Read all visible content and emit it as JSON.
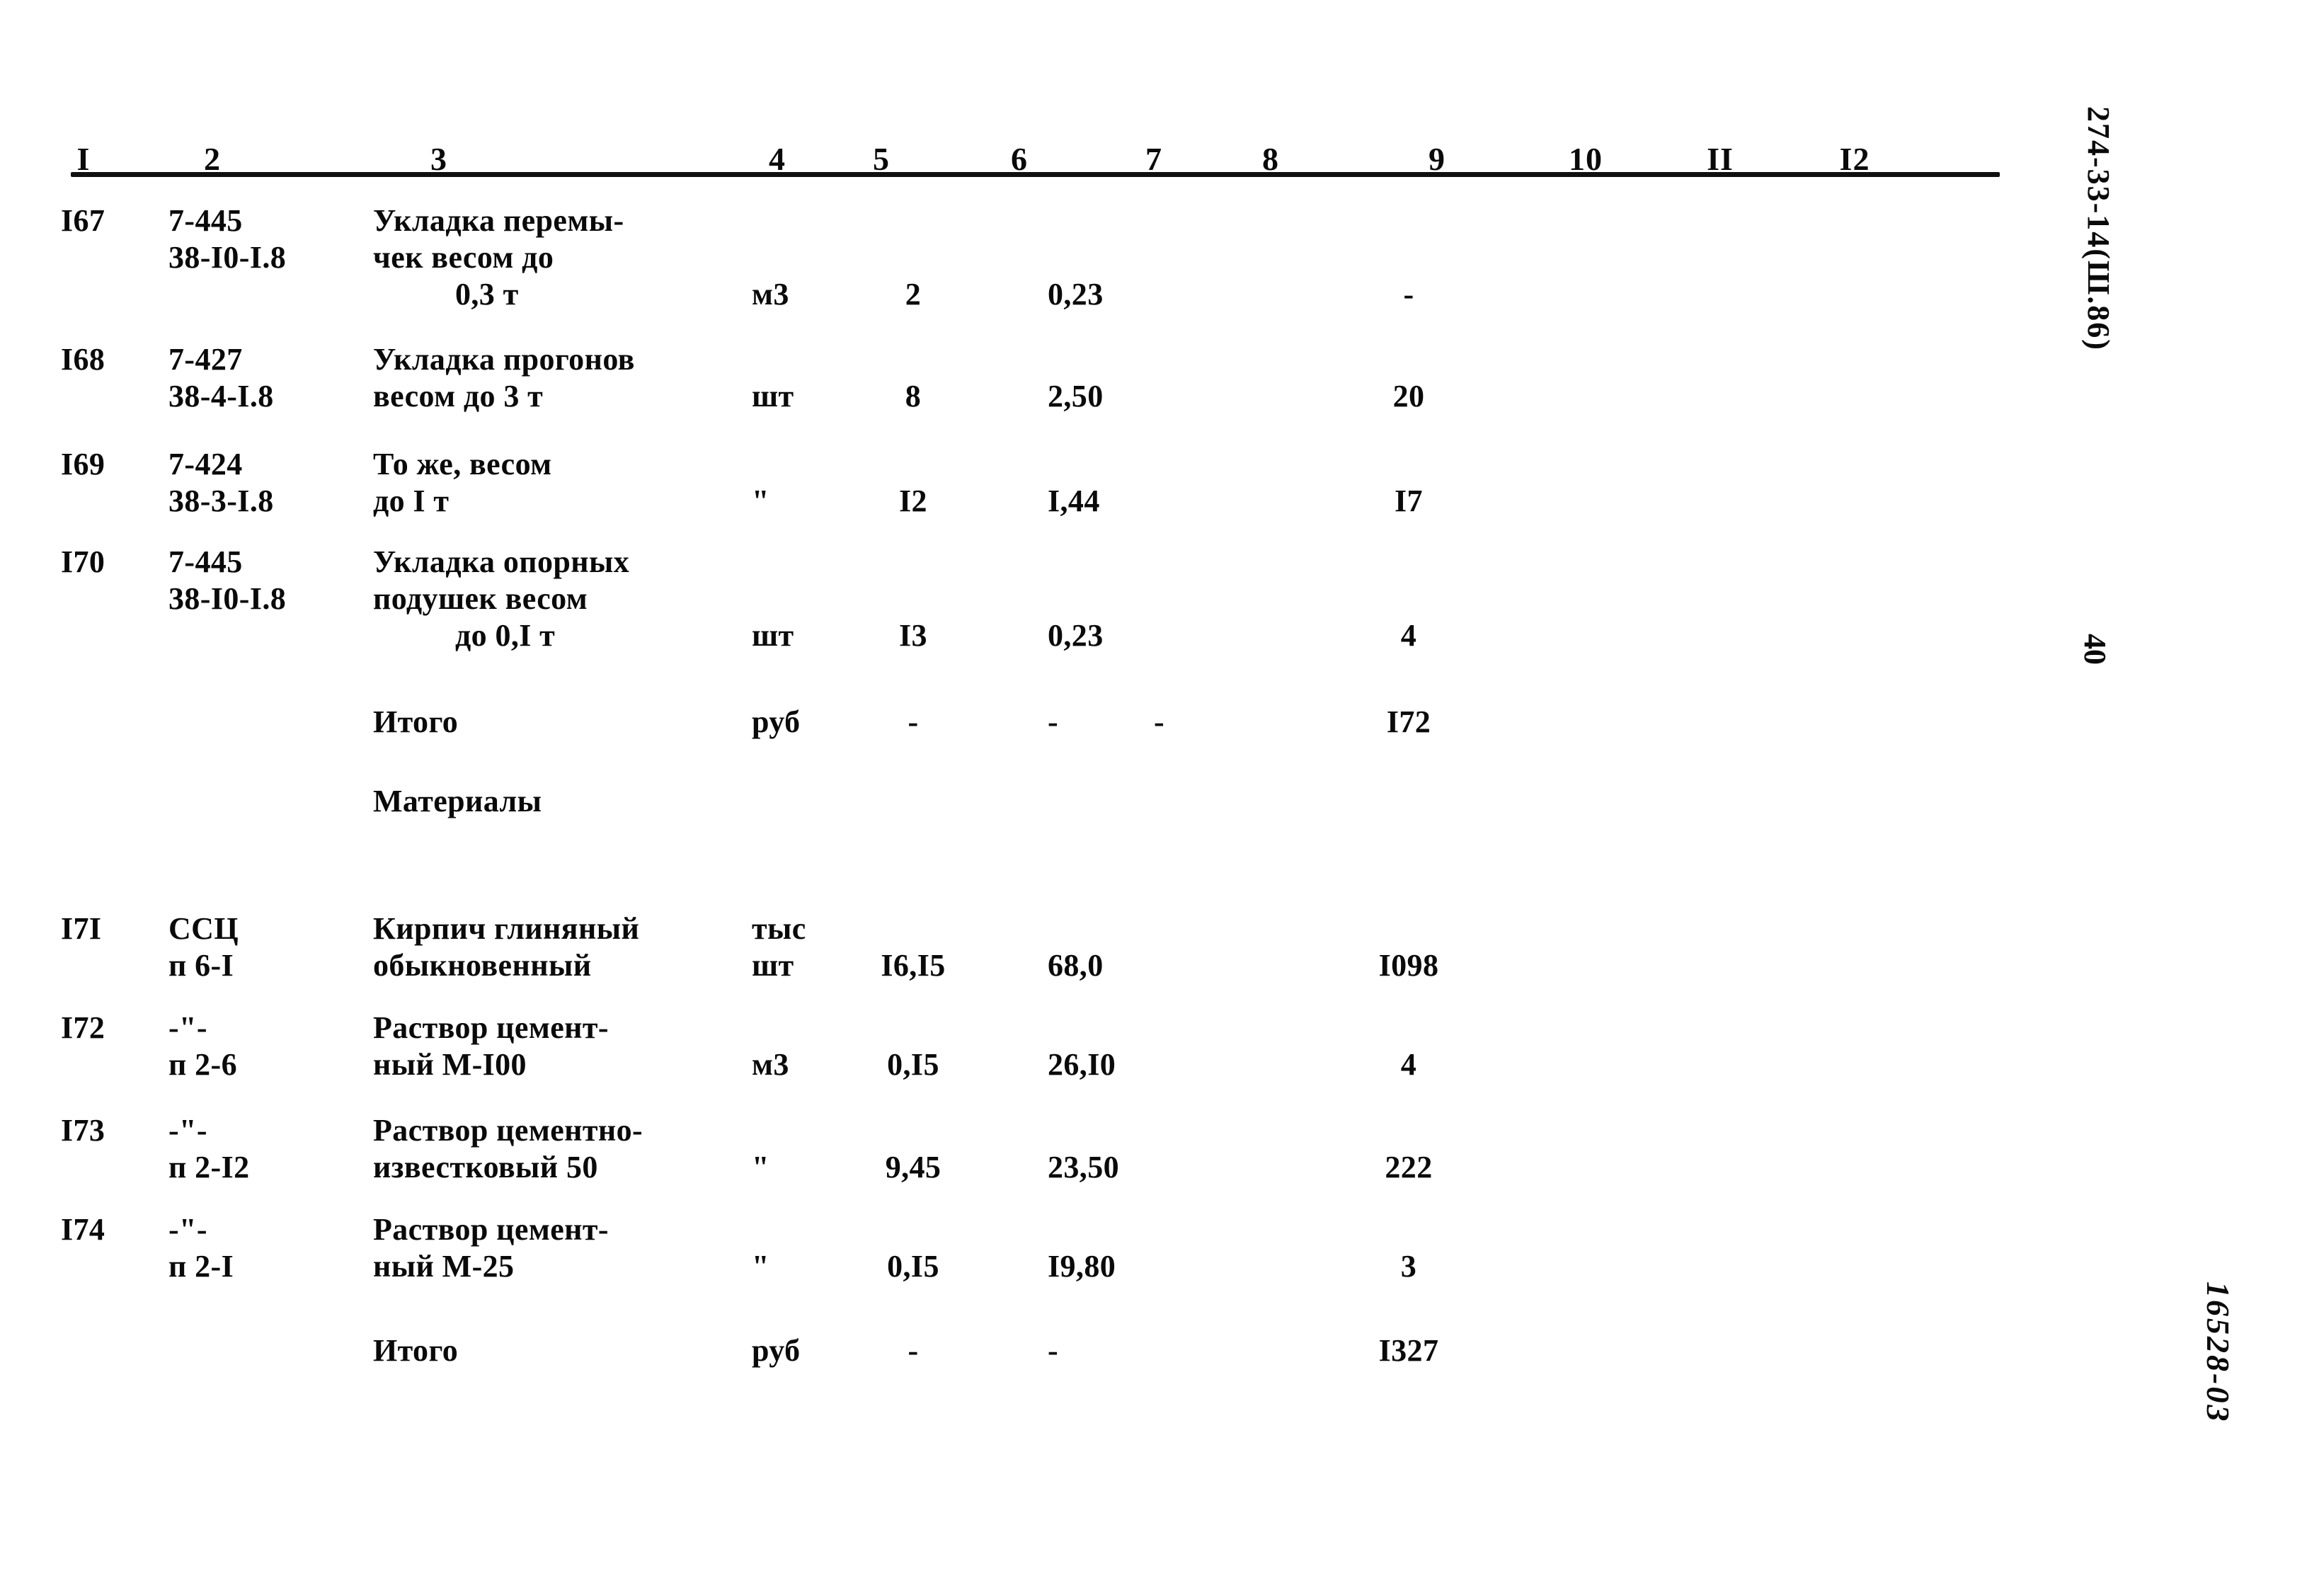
{
  "document": {
    "doc_code": "274-33-14(Ш.86)",
    "page_number": "40",
    "archive_id": "16528-03"
  },
  "table": {
    "column_headers": [
      "I",
      "2",
      "3",
      "4",
      "5",
      "6",
      "7",
      "8",
      "9",
      "10",
      "II",
      "I2"
    ],
    "rows": [
      {
        "num": "I67",
        "code_line1": "7-445",
        "code_line2": "38-I0-I.8",
        "name_line1": "Укладка перемы-",
        "name_line2": "чек весом до",
        "name_line3": "0,3 т",
        "unit": "м3",
        "qty": "2",
        "price": "0,23",
        "col7": "",
        "col9": "-"
      },
      {
        "num": "I68",
        "code_line1": "7-427",
        "code_line2": "38-4-I.8",
        "name_line1": "Укладка прогонов",
        "name_line2": "весом до 3 т",
        "name_line3": "",
        "unit": "шт",
        "qty": "8",
        "price": "2,50",
        "col7": "",
        "col9": "20"
      },
      {
        "num": "I69",
        "code_line1": "7-424",
        "code_line2": "38-3-I.8",
        "name_line1": "То же, весом",
        "name_line2": "до I т",
        "name_line3": "",
        "unit": "\"",
        "qty": "I2",
        "price": "I,44",
        "col7": "",
        "col9": "I7"
      },
      {
        "num": "I70",
        "code_line1": "7-445",
        "code_line2": "38-I0-I.8",
        "name_line1": "Укладка опорных",
        "name_line2": "подушек весом",
        "name_line3": "до 0,I т",
        "unit": "шт",
        "qty": "I3",
        "price": "0,23",
        "col7": "",
        "col9": "4"
      },
      {
        "num": "",
        "code_line1": "",
        "code_line2": "",
        "name_line1": "Итого",
        "name_line2": "",
        "name_line3": "",
        "unit": "руб",
        "qty": "-",
        "price": "-",
        "col7": "-",
        "col9": "I72"
      },
      {
        "num": "",
        "code_line1": "",
        "code_line2": "",
        "name_line1": "Материалы",
        "name_line2": "",
        "name_line3": "",
        "unit": "",
        "qty": "",
        "price": "",
        "col7": "",
        "col9": ""
      },
      {
        "num": "I7I",
        "code_line1": "ССЦ",
        "code_line2": "п 6-I",
        "name_line1": "Кирпич глиняный",
        "name_line2": "обыкновенный",
        "name_line3": "",
        "unit": "тыс\nшт",
        "qty": "I6,I5",
        "price": "68,0",
        "col7": "",
        "col9": "I098"
      },
      {
        "num": "I72",
        "code_line1": "-\"-",
        "code_line2": "п 2-6",
        "name_line1": "Раствор цемент-",
        "name_line2": "ный М-I00",
        "name_line3": "",
        "unit": "м3",
        "qty": "0,I5",
        "price": "26,I0",
        "col7": "",
        "col9": "4"
      },
      {
        "num": "I73",
        "code_line1": "-\"-",
        "code_line2": "п 2-I2",
        "name_line1": "Раствор цементно-",
        "name_line2": "известковый 50",
        "name_line3": "",
        "unit": "\"",
        "qty": "9,45",
        "price": "23,50",
        "col7": "",
        "col9": "222"
      },
      {
        "num": "I74",
        "code_line1": "-\"-",
        "code_line2": "п 2-I",
        "name_line1": "Раствор цемент-",
        "name_line2": "ный М-25",
        "name_line3": "",
        "unit": "\"",
        "qty": "0,I5",
        "price": "I9,80",
        "col7": "",
        "col9": "3"
      },
      {
        "num": "",
        "code_line1": "",
        "code_line2": "",
        "name_line1": "Итого",
        "name_line2": "",
        "name_line3": "",
        "unit": "руб",
        "qty": "-",
        "price": "-",
        "col7": "",
        "col9": "I327"
      }
    ]
  }
}
